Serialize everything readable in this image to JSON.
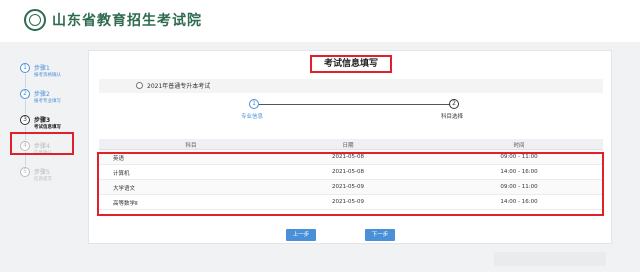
{
  "header": {
    "site_title": "山东省教育招生考试院",
    "logo_icon": "seal-logo-icon",
    "brand_color": "#2e6b4f"
  },
  "steps": [
    {
      "num": "1",
      "title": "步骤1",
      "desc": "报考资格确认",
      "state": "done"
    },
    {
      "num": "2",
      "title": "步骤2",
      "desc": "报考专业填写",
      "state": "done"
    },
    {
      "num": "3",
      "title": "步骤3",
      "desc": "考试信息填写",
      "state": "current"
    },
    {
      "num": "4",
      "title": "步骤4",
      "desc": "信息确认",
      "state": "pending"
    },
    {
      "num": "5",
      "title": "步骤5",
      "desc": "信息提交",
      "state": "pending"
    }
  ],
  "panel": {
    "title": "考试信息填写",
    "exam_name": "2021年普通专升本考试"
  },
  "progress": [
    {
      "num": "1",
      "label": "专业信息"
    },
    {
      "num": "2",
      "label": "科目选择"
    }
  ],
  "table": {
    "headers": [
      "科目",
      "日期",
      "时间"
    ],
    "rows": [
      [
        "英语",
        "2021-05-08",
        "09:00 - 11:00"
      ],
      [
        "计算机",
        "2021-05-08",
        "14:00 - 16:00"
      ],
      [
        "大学语文",
        "2021-05-09",
        "09:00 - 11:00"
      ],
      [
        "高等数学Ⅱ",
        "2021-05-09",
        "14:00 - 16:00"
      ]
    ]
  },
  "buttons": {
    "prev": "上一步",
    "next": "下一步"
  },
  "colors": {
    "accent": "#4a90d9",
    "highlight": "#e0202a",
    "background": "#f1f2f4"
  }
}
